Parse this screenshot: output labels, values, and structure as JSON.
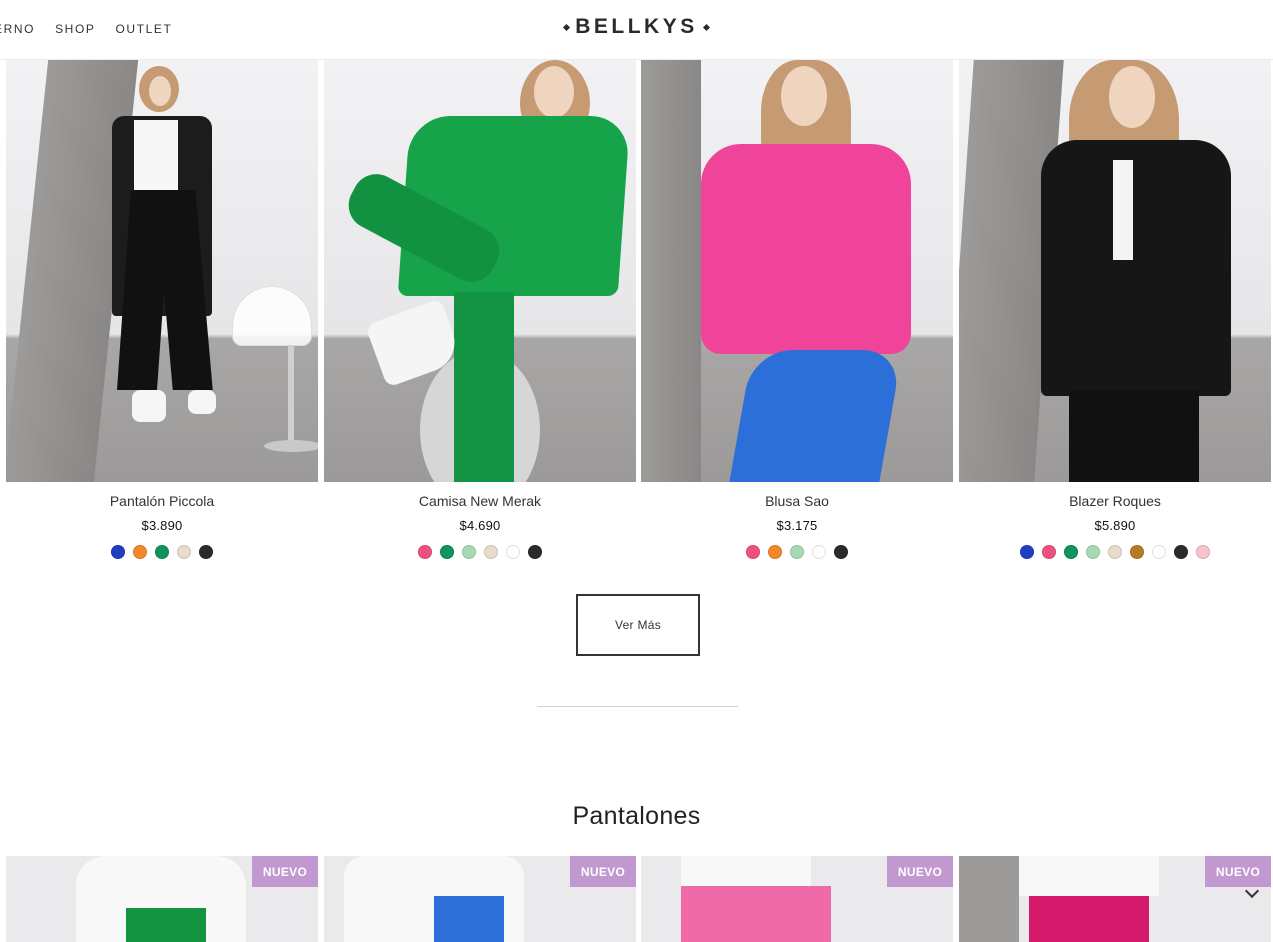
{
  "header": {
    "nav": [
      "ERNO",
      "SHOP",
      "OUTLET"
    ],
    "logo": "BELLKYS"
  },
  "products": [
    {
      "name": "Pantalón Piccola",
      "price": "$3.890",
      "colors": [
        "#1f3fc0",
        "#f2872c",
        "#0f9460",
        "#e9dccb",
        "#2b2b2b"
      ]
    },
    {
      "name": "Camisa New Merak",
      "price": "$4.690",
      "colors": [
        "#f0507e",
        "#0f9460",
        "#a8d9b4",
        "#e9dccb",
        "#ffffff",
        "#2b2b2b"
      ]
    },
    {
      "name": "Blusa Sao",
      "price": "$3.175",
      "colors": [
        "#f0507e",
        "#f2872c",
        "#a8d9b4",
        "#ffffff",
        "#2b2b2b"
      ]
    },
    {
      "name": "Blazer Roques",
      "price": "$5.890",
      "colors": [
        "#1f3fc0",
        "#f0507e",
        "#0f9460",
        "#a8d9b4",
        "#e9dccb",
        "#b77a27",
        "#ffffff",
        "#2b2b2b",
        "#f6c3cc"
      ]
    }
  ],
  "ver_mas": "Ver Más",
  "section": {
    "title": "Pantalones",
    "badge": "NUEVO",
    "badges": [
      "NUEVO",
      "NUEVO",
      "NUEVO",
      "NUEVO"
    ]
  },
  "colors": {
    "badge": "#c298d0",
    "green_outfit": "#16a34a",
    "pink_top": "#f0449a",
    "blue_pants": "#2d6fd8"
  }
}
